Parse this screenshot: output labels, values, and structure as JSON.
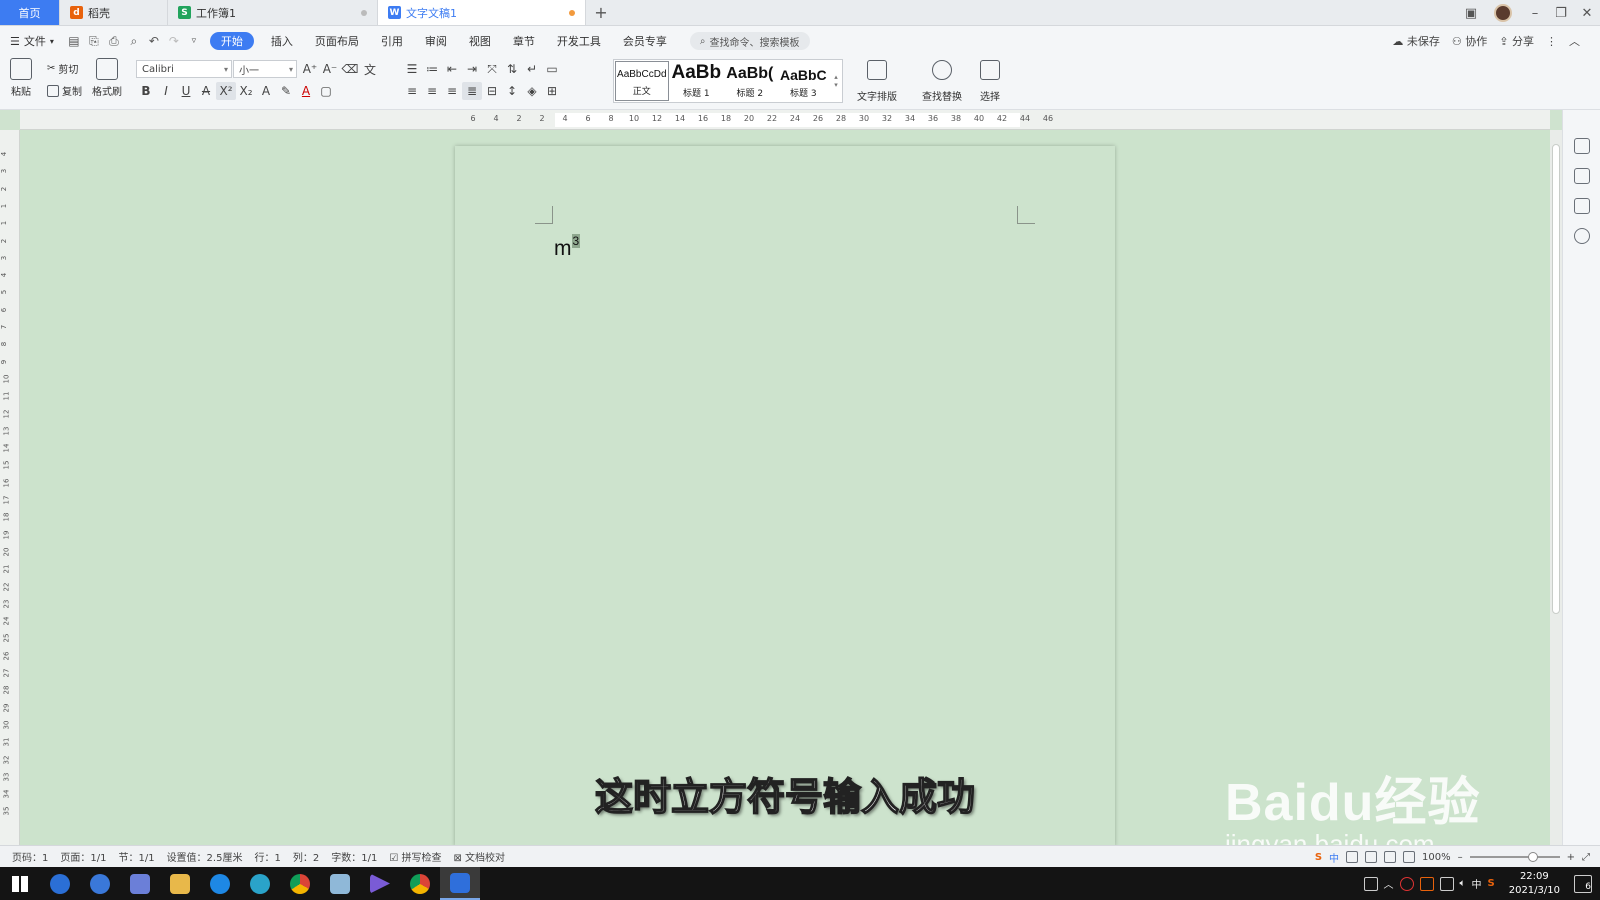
{
  "tabs": [
    {
      "label": "首页"
    },
    {
      "label": "稻壳",
      "icon": "daoke-icon",
      "color": "#e8620c"
    },
    {
      "label": "工作簿1",
      "icon": "spreadsheet-icon",
      "color": "#22a45d"
    },
    {
      "label": "文字文稿1",
      "icon": "writer-icon",
      "color": "#3d7cf2"
    }
  ],
  "menu": {
    "file": "文件",
    "items": [
      "开始",
      "插入",
      "页面布局",
      "引用",
      "审阅",
      "视图",
      "章节",
      "开发工具",
      "会员专享"
    ],
    "active": "开始",
    "search_placeholder": "查找命令、搜索模板",
    "right": [
      "未保存",
      "协作",
      "分享"
    ]
  },
  "ribbon": {
    "paste": "粘贴",
    "cut": "剪切",
    "copy": "复制",
    "format_painter": "格式刷",
    "font_name": "Calibri",
    "font_size": "小一",
    "styles": [
      {
        "sample": "AaBbCcDd",
        "name": "正文"
      },
      {
        "sample": "AaBb",
        "name": "标题 1"
      },
      {
        "sample": "AaBb(",
        "name": "标题 2"
      },
      {
        "sample": "AaBbC",
        "name": "标题 3"
      }
    ],
    "text_layout": "文字排版",
    "find_replace": "查找替换",
    "select": "选择"
  },
  "ruler": {
    "h_ticks": [
      "6",
      "4",
      "2",
      "2",
      "4",
      "6",
      "8",
      "10",
      "12",
      "14",
      "16",
      "18",
      "20",
      "22",
      "24",
      "26",
      "28",
      "30",
      "32",
      "34",
      "36",
      "38",
      "40",
      "42",
      "44",
      "46"
    ],
    "v_ticks": [
      "4",
      "3",
      "2",
      "1",
      "1",
      "2",
      "3",
      "4",
      "5",
      "6",
      "7",
      "8",
      "9",
      "10",
      "11",
      "12",
      "13",
      "14",
      "15",
      "16",
      "17",
      "18",
      "19",
      "20",
      "21",
      "22",
      "23",
      "24",
      "25",
      "26",
      "27",
      "28",
      "29",
      "30",
      "31",
      "32",
      "33",
      "34",
      "35"
    ]
  },
  "document": {
    "base": "m",
    "superscript": "3"
  },
  "caption": "这时立方符号输入成功",
  "watermark": {
    "main": "Baidu经验",
    "sub": "jingyan.baidu.com"
  },
  "statusbar": {
    "items": [
      "页码：1",
      "页面：1/1",
      "节：1/1",
      "设置值：2.5厘米",
      "行：1",
      "列：2",
      "字数：1/1",
      "拼写检查",
      "文档校对"
    ],
    "zoom": "100%"
  },
  "taskbar": {
    "time": "22:09",
    "date": "2021/3/10",
    "ime": "中",
    "notifications": "6"
  },
  "colors": {
    "accent": "#3d7cf2",
    "page_bg": "#cde3cd"
  }
}
